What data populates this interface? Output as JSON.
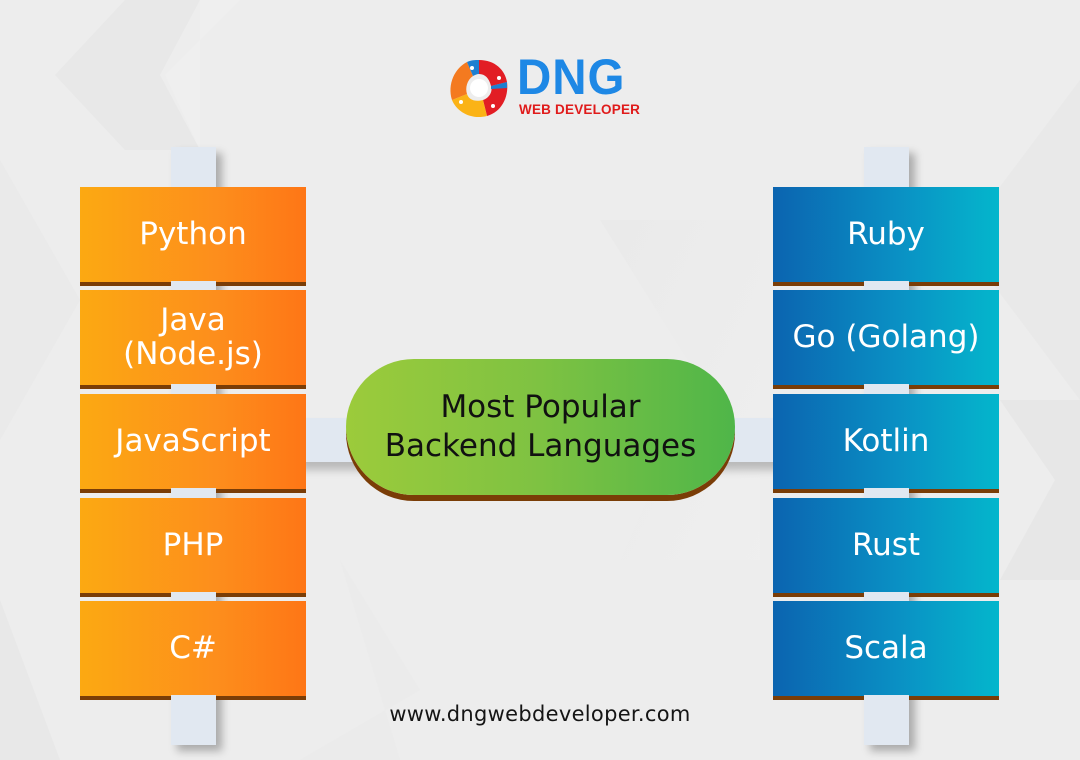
{
  "brand": {
    "logo_title": "DNG",
    "logo_subtitle": "WEB DEVELOPER",
    "colors": {
      "title": "#1e88e5",
      "subtitle": "#e01b1b"
    }
  },
  "center": {
    "line1": "Most Popular",
    "line2": "Backend Languages",
    "color": "#7ec242"
  },
  "left_column": {
    "color": "#fd8e1c",
    "items": [
      {
        "label": "Python"
      },
      {
        "label": "Java (Node.js)",
        "line1": "Java",
        "line2": "(Node.js)"
      },
      {
        "label": "JavaScript"
      },
      {
        "label": "PHP"
      },
      {
        "label": "C#"
      }
    ]
  },
  "right_column": {
    "color": "#0a90c4",
    "items": [
      {
        "label": "Ruby"
      },
      {
        "label": "Go (Golang)"
      },
      {
        "label": "Kotlin"
      },
      {
        "label": "Rust"
      },
      {
        "label": "Scala"
      }
    ]
  },
  "footer": {
    "url": "www.dngwebdeveloper.com"
  }
}
